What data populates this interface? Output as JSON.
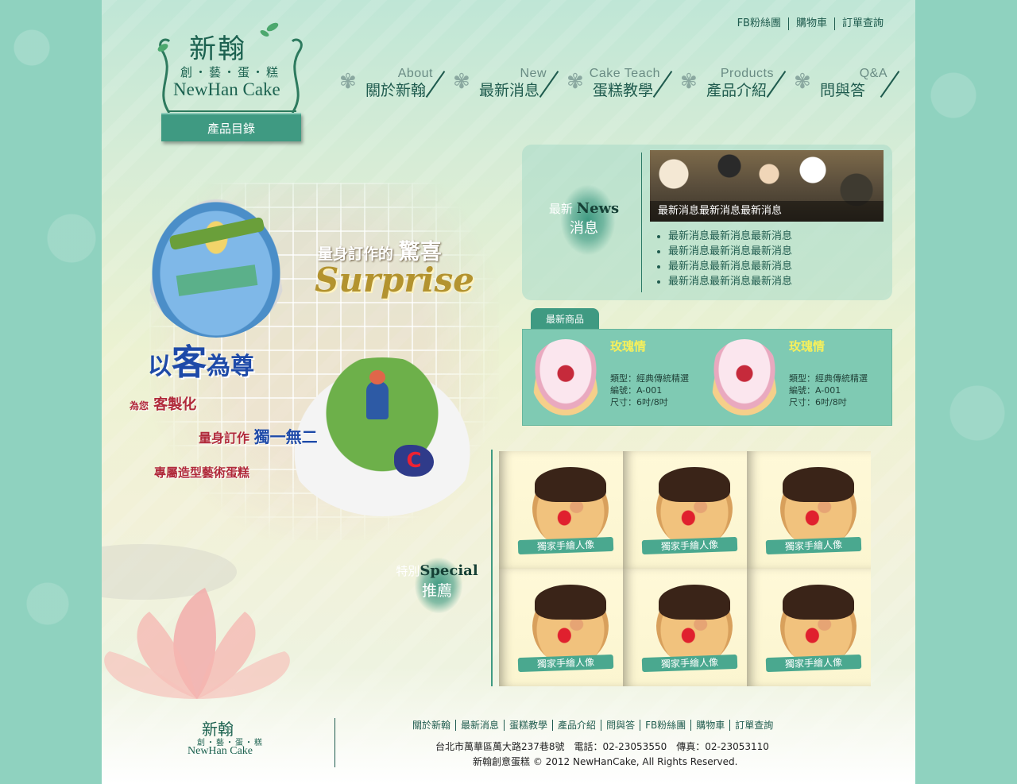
{
  "colors": {
    "brand_green": "#3f9a82",
    "dark_green": "#1f5b4e",
    "bg_mint": "#8fd2bf",
    "product_name": "#f7f05a"
  },
  "top_links": [
    "FB粉絲團",
    "購物車",
    "訂單查詢"
  ],
  "logo": {
    "cn": "新翰",
    "sub": "創‧藝‧蛋‧糕",
    "en": "NewHan Cake"
  },
  "catalog_button": "產品目錄",
  "nav": [
    {
      "en": "About",
      "cn": "關於新翰"
    },
    {
      "en": "New",
      "cn": "最新消息"
    },
    {
      "en": "Cake Teach",
      "cn": "蛋糕教學"
    },
    {
      "en": "Products",
      "cn": "產品介紹"
    },
    {
      "en": "Q&A",
      "cn": "問與答"
    }
  ],
  "hero": {
    "surprise_prefix": "量身訂作的",
    "surprise_big": "驚喜",
    "surprise_en": "Surprise",
    "customer_pre": "以",
    "customer_big": "客",
    "customer_post": "為尊",
    "custom_pre": "為您",
    "custom_main": "客製化",
    "unique_pre": "量身訂作",
    "unique_main": "獨一無二",
    "art": "專屬造型藝術蛋糕"
  },
  "news": {
    "title_cn_1": "最新",
    "title_en": "News",
    "title_cn_2": "消息",
    "photo_caption": "最新消息最新消息最新消息",
    "items": [
      "最新消息最新消息最新消息",
      "最新消息最新消息最新消息",
      "最新消息最新消息最新消息",
      "最新消息最新消息最新消息"
    ]
  },
  "new_products": {
    "tab": "最新商品",
    "items": [
      {
        "name": "玫瑰情",
        "type": "類型：經典傳統精選",
        "code": "編號：A-001",
        "size": "尺寸：6吋/8吋"
      },
      {
        "name": "玫瑰情",
        "type": "類型：經典傳統精選",
        "code": "編號：A-001",
        "size": "尺寸：6吋/8吋"
      }
    ]
  },
  "special": {
    "title_cn_1": "特別",
    "title_en": "Special",
    "title_cn_2": "推薦",
    "items": [
      {
        "label": "獨家手繪人像"
      },
      {
        "label": "獨家手繪人像"
      },
      {
        "label": "獨家手繪人像"
      },
      {
        "label": "獨家手繪人像"
      },
      {
        "label": "獨家手繪人像"
      },
      {
        "label": "獨家手繪人像"
      }
    ]
  },
  "footer": {
    "logo": {
      "cn": "新翰",
      "sub": "創‧藝‧蛋‧糕",
      "en": "NewHan Cake"
    },
    "links": [
      "關於新翰",
      "最新消息",
      "蛋糕教學",
      "產品介紹",
      "問與答",
      "FB粉絲團",
      "購物車",
      "訂單查詢"
    ],
    "address": "台北市萬華區萬大路237巷8號　電話：02-23053550　傳真：02-23053110",
    "copyright": "新翰創意蛋糕 © 2012 NewHanCake, All Rights Reserved."
  }
}
